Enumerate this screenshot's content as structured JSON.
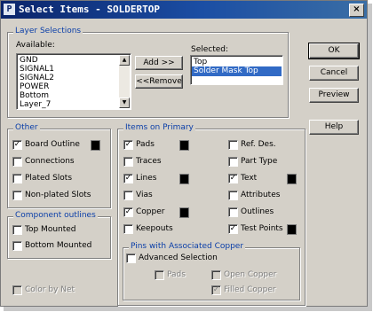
{
  "window": {
    "title": "Select Items - SOLDERTOP",
    "close_glyph": "×",
    "icon_glyph": "P"
  },
  "layer_selections": {
    "legend": "Layer Selections",
    "available_label": "Available:",
    "available": [
      "GND",
      "SIGNAL1",
      "SIGNAL2",
      "POWER",
      "Bottom",
      "Layer_7"
    ],
    "selected_label": "Selected:",
    "selected": [
      "Top",
      "Solder Mask Top"
    ],
    "selected_highlight_index": 1,
    "add_button": "Add >>",
    "remove_button": "<<Remove"
  },
  "buttons": {
    "ok": "OK",
    "cancel": "Cancel",
    "preview": "Preview",
    "help": "Help"
  },
  "other": {
    "legend": "Other",
    "items": [
      {
        "label": "Board Outline",
        "checked": true,
        "swatch": "#000000"
      },
      {
        "label": "Connections",
        "checked": false
      },
      {
        "label": "Plated Slots",
        "checked": false
      },
      {
        "label": "Non-plated Slots",
        "checked": false
      }
    ]
  },
  "component_outlines": {
    "legend": "Component outlines",
    "items": [
      {
        "label": "Top Mounted",
        "checked": false
      },
      {
        "label": "Bottom Mounted",
        "checked": false
      }
    ]
  },
  "color_by_net": {
    "label": "Color by Net",
    "checked": false,
    "disabled": true
  },
  "items_on_primary": {
    "legend": "Items on Primary",
    "left": [
      {
        "label": "Pads",
        "checked": true,
        "swatch": "#000000"
      },
      {
        "label": "Traces",
        "checked": false
      },
      {
        "label": "Lines",
        "checked": true,
        "swatch": "#000000"
      },
      {
        "label": "Vias",
        "checked": false
      },
      {
        "label": "Copper",
        "checked": true,
        "swatch": "#000000"
      },
      {
        "label": "Keepouts",
        "checked": false
      }
    ],
    "right": [
      {
        "label": "Ref. Des.",
        "checked": false
      },
      {
        "label": "Part Type",
        "checked": false
      },
      {
        "label": "Text",
        "checked": true,
        "swatch": "#000000"
      },
      {
        "label": "Attributes",
        "checked": false
      },
      {
        "label": "Outlines",
        "checked": false
      },
      {
        "label": "Test Points",
        "checked": true,
        "swatch": "#000000"
      }
    ]
  },
  "pins_copper": {
    "legend": "Pins with Associated Copper",
    "advanced": {
      "label": "Advanced Selection",
      "checked": false
    },
    "pads": {
      "label": "Pads",
      "checked": false,
      "disabled": true
    },
    "open_copper": {
      "label": "Open Copper",
      "checked": false,
      "disabled": true
    },
    "filled_copper": {
      "label": "Filled Copper",
      "checked": true,
      "disabled": true
    }
  }
}
